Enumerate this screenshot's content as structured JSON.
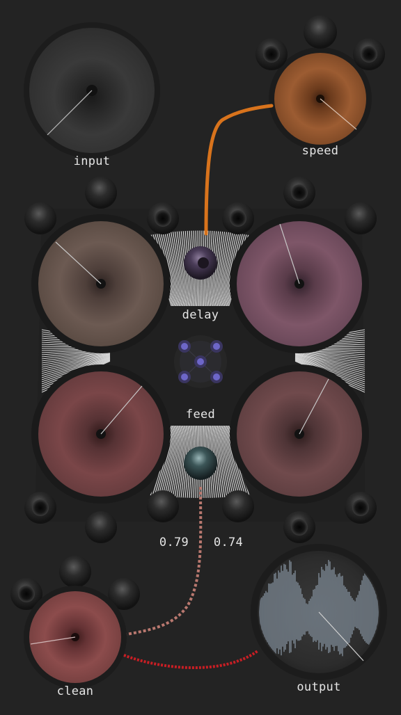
{
  "labels": {
    "input": "input",
    "speed": "speed",
    "delay": "delay",
    "feed": "feed",
    "clean": "clean",
    "output": "output"
  },
  "readouts": {
    "left": "0.79",
    "right": "0.74"
  },
  "colors": {
    "background": "#232323",
    "cable_orange": "#d8731c",
    "cable_pink_dotted": "#b9786f",
    "cable_red": "#c81e24",
    "knob_input": "#383838",
    "knob_speed": "#9a5a30",
    "knob_delay_left": "#6b5750",
    "knob_delay_right": "#7d5568",
    "knob_feed_left": "#7a4648",
    "knob_feed_right": "#6f4a4c",
    "knob_clean": "#8a4a4a",
    "matrix_dot": "#6d66c8"
  }
}
